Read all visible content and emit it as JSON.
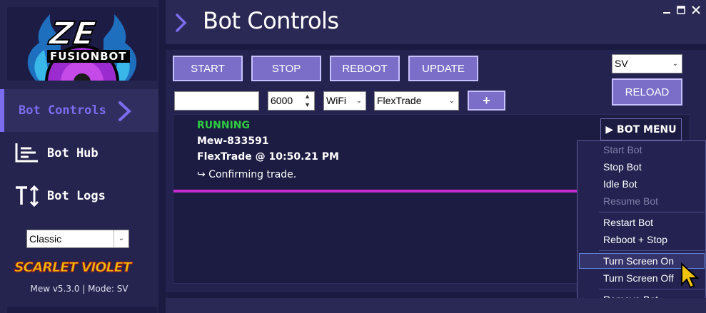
{
  "sidebar": {
    "logo": {
      "title": "ZE",
      "subtitle": "FUSIONBOT"
    },
    "nav": [
      {
        "label": "Bot Controls",
        "icon": "chevron-right-icon",
        "active": true
      },
      {
        "label": "Bot Hub",
        "icon": "chart-icon",
        "active": false
      },
      {
        "label": "Bot Logs",
        "icon": "text-size-icon",
        "active": false
      }
    ],
    "theme_select": "Classic",
    "game_logo": "SCARLET VIOLET",
    "version": "Mew v5.3.0 | Mode: SV"
  },
  "header": {
    "title": "Bot Controls",
    "window_controls": [
      "minimize-icon",
      "maximize-icon",
      "close-icon"
    ]
  },
  "controls": {
    "start": "START",
    "stop": "STOP",
    "reboot": "REBOOT",
    "update": "UPDATE",
    "game_select": "SV",
    "reload": "RELOAD",
    "ip_input": "",
    "port_input": "6000",
    "protocol_select": "WiFi",
    "routine_select": "FlexTrade",
    "add": "+"
  },
  "bot": {
    "status": "RUNNING",
    "name": "Mew-833591",
    "routine_time": "FlexTrade @ 10:50.21 PM",
    "action": "↪ Confirming trade.",
    "menu_button": "▶ BOT MENU"
  },
  "bot_menu": {
    "items": [
      {
        "label": "Start Bot",
        "disabled": true
      },
      {
        "label": "Stop Bot",
        "disabled": false
      },
      {
        "label": "Idle Bot",
        "disabled": false
      },
      {
        "label": "Resume Bot",
        "disabled": true
      },
      {
        "label": "Restart Bot",
        "disabled": false
      },
      {
        "label": "Reboot + Stop",
        "disabled": false
      },
      {
        "label": "Turn Screen On",
        "disabled": false,
        "hovered": true
      },
      {
        "label": "Turn Screen Off",
        "disabled": false
      },
      {
        "label": "Remove Bot",
        "disabled": false
      }
    ]
  },
  "colors": {
    "accent": "#7c6cf0",
    "running": "#2ecc40",
    "progress": "#c42ad0",
    "background": "#1b1a40"
  }
}
